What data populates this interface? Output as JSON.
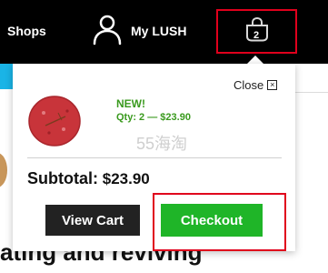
{
  "nav": {
    "shops_label": "Shops",
    "account_label": "My LUSH",
    "cart_count": "2"
  },
  "background": {
    "heading_fragment": "ating and reviving"
  },
  "cart_dropdown": {
    "close_label": "Close",
    "item": {
      "badge": "NEW!",
      "qty_line": "Qty: 2 — $23.90"
    },
    "watermark": "55海淘",
    "subtotal_label": "Subtotal:",
    "subtotal_value": "$23.90",
    "view_cart_label": "View Cart",
    "checkout_label": "Checkout"
  },
  "icons": {
    "account": "user-icon",
    "cart": "shopping-bag-icon",
    "close": "close-icon"
  },
  "colors": {
    "topbar": "#000000",
    "accent_blue": "#1ab4e6",
    "checkout_green": "#1fb528",
    "new_green": "#3a9a1e",
    "highlight_red": "#e0001c",
    "view_cart_bg": "#222222"
  }
}
